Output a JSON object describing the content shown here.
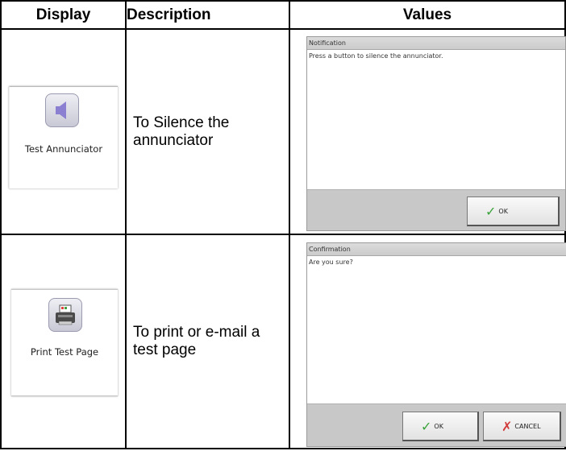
{
  "table": {
    "headers": [
      "Display",
      "Description",
      "Values"
    ],
    "rows": [
      {
        "display": {
          "label": "Test Annunciator",
          "icon": "speaker-icon"
        },
        "description": "To Silence the annunciator",
        "dialog": {
          "title": "Notification",
          "message": "Press a button to silence the annunciator.",
          "buttons": [
            "OK"
          ]
        }
      },
      {
        "display": {
          "label": "Print Test Page",
          "icon": "printer-icon"
        },
        "description": "To print or e-mail a test page",
        "dialog": {
          "title": "Confirmation",
          "message": "Are you sure?",
          "buttons": [
            "OK",
            "CANCEL"
          ]
        }
      }
    ]
  },
  "colors": {
    "check": "#3aa33a",
    "cross": "#d23a3a",
    "speaker": "#8a7fd0"
  }
}
